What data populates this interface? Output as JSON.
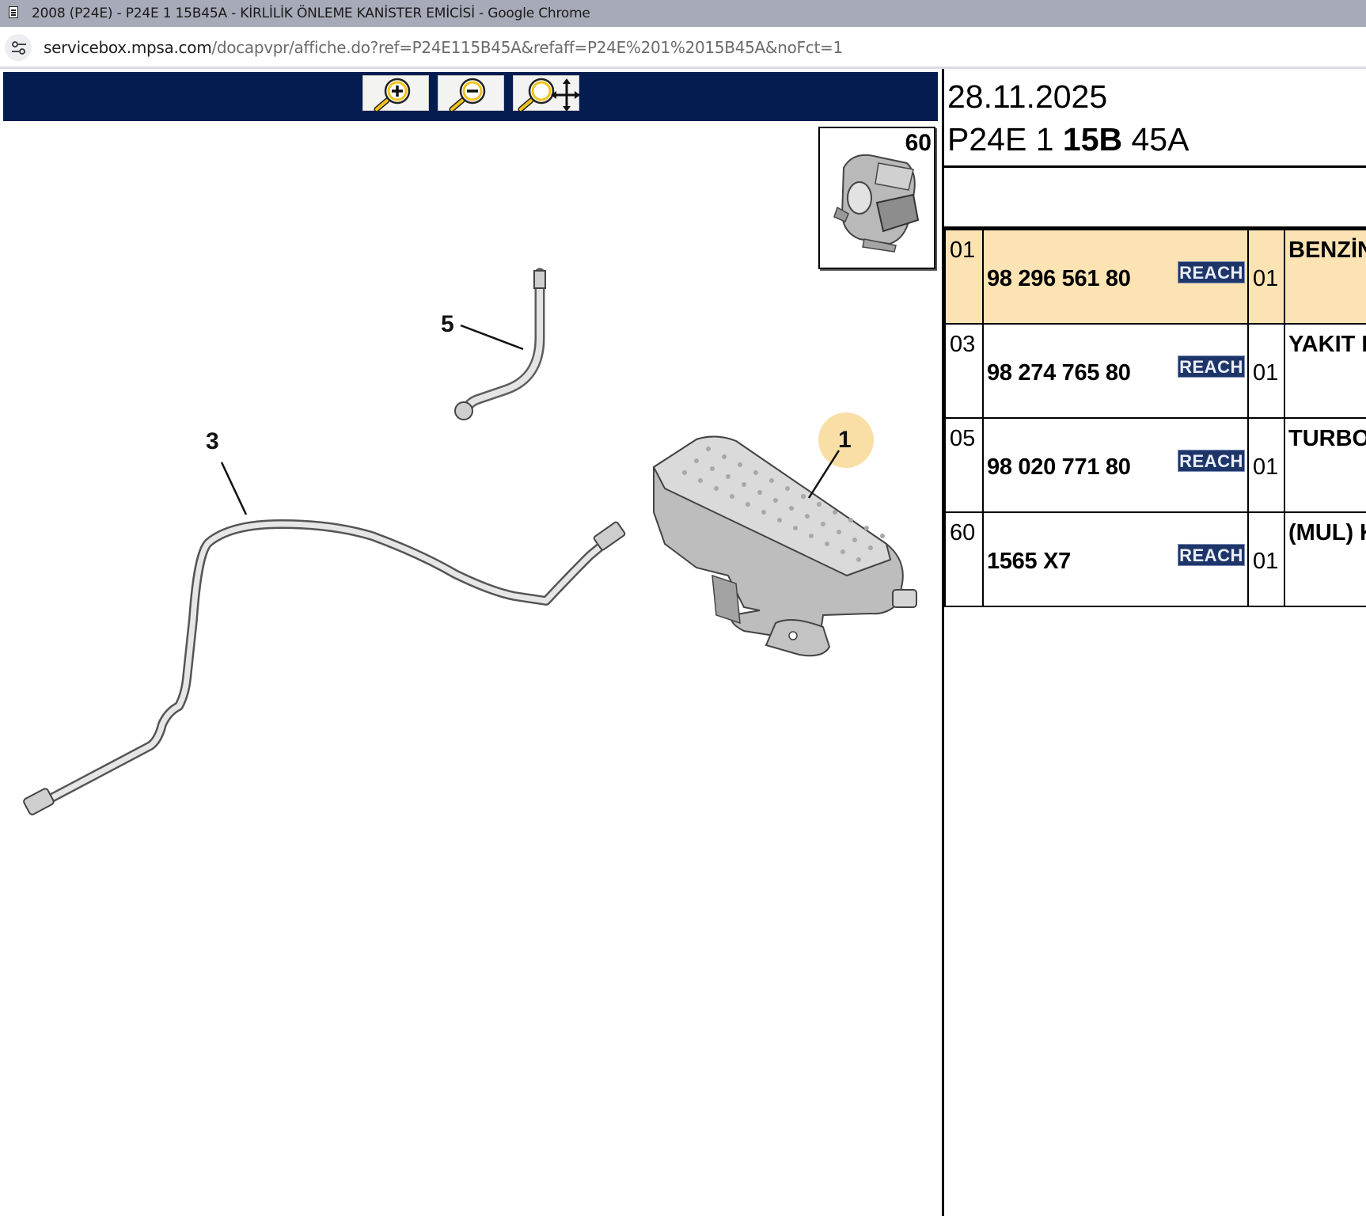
{
  "window": {
    "title": "2008 (P24E) - P24E 1 15B45A - KİRLİLİK ÖNLEME KANİSTER EMİCİSİ - Google Chrome"
  },
  "address_bar": {
    "host": "servicebox.mpsa.com",
    "path": "/docapvpr/affiche.do?ref=P24E115B45A&refaff=P24E%201%2015B45A&noFct=1"
  },
  "diagram": {
    "toolbar": {
      "icons": [
        "zoom-in-icon",
        "zoom-out-icon",
        "zoom-pan-icon"
      ]
    },
    "inset_number": "60",
    "callouts": [
      "5",
      "3",
      "1"
    ],
    "highlight_color": "#f9dfa6"
  },
  "parts_panel": {
    "date": "28.11.2025",
    "code_part1": "P24E 1 ",
    "code_bold": "15B",
    "code_part2": " 45A",
    "selected_row_color": "#fbe3b3",
    "rows": [
      {
        "pos": "01",
        "ref": "98 296 561 80",
        "badge": "REACH",
        "qty": "01",
        "desc": "BENZİN"
      },
      {
        "pos": "03",
        "ref": "98 274 765 80",
        "badge": "REACH",
        "qty": "01",
        "desc": "YAKIT B"
      },
      {
        "pos": "05",
        "ref": "98 020 771 80",
        "badge": "REACH",
        "qty": "01",
        "desc": "TURBO"
      },
      {
        "pos": "60",
        "ref": "1565 X7",
        "badge": "REACH",
        "qty": "01",
        "desc": "(MUL) K"
      }
    ]
  }
}
